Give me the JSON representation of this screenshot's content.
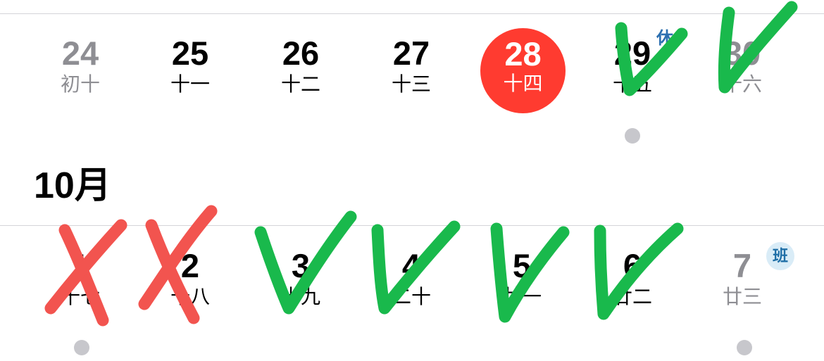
{
  "calendar": {
    "week1": [
      {
        "day": "24",
        "lunar": "初十"
      },
      {
        "day": "25",
        "lunar": "十一"
      },
      {
        "day": "26",
        "lunar": "十二"
      },
      {
        "day": "27",
        "lunar": "十三"
      },
      {
        "day": "28",
        "lunar": "十四"
      },
      {
        "day": "29",
        "lunar": "十五"
      },
      {
        "day": "30",
        "lunar": "十六"
      }
    ],
    "holiday_badge": "休",
    "month_title": "10月",
    "week2": [
      {
        "day": "1",
        "lunar": "十七"
      },
      {
        "day": "2",
        "lunar": "十八"
      },
      {
        "day": "3",
        "lunar": "十九"
      },
      {
        "day": "4",
        "lunar": "二十"
      },
      {
        "day": "5",
        "lunar": "廿一"
      },
      {
        "day": "6",
        "lunar": "廿二"
      },
      {
        "day": "7",
        "lunar": "廿三"
      }
    ],
    "workday_badge": "班",
    "today_color": "#ff3b30",
    "weekend_color": "#8e8e93"
  },
  "annotations": {
    "green_check_color": "#19b94c",
    "red_x_color": "#f2544f"
  }
}
